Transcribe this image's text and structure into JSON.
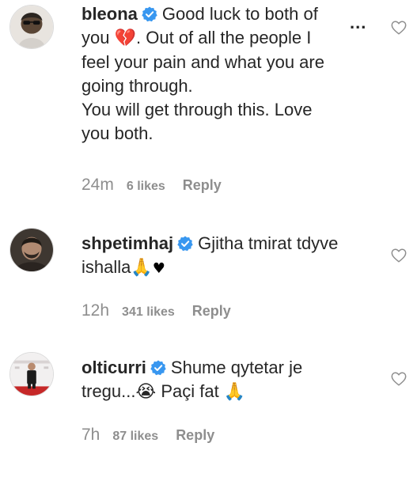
{
  "comments": [
    {
      "username": "bleona",
      "lines": [
        "Good luck to both of",
        "you",
        ". Out of all the people I",
        "feel your pain and what you are",
        "going through.",
        "You will get through this. Love",
        "you both."
      ],
      "emoji_1": "💔",
      "time": "24m",
      "likes": "6 likes",
      "reply": "Reply",
      "more_label": "...",
      "icon": "heart-outline-icon"
    },
    {
      "username": "shpetimhaj",
      "lines": [
        "Gjitha tmirat tdyve",
        "ishalla"
      ],
      "emoji_1": "🙏",
      "emoji_2": "♥",
      "time": "12h",
      "likes": "341 likes",
      "reply": "Reply",
      "icon": "heart-outline-icon"
    },
    {
      "username": "olticurri",
      "lines": [
        "Shume qytetar je",
        "tregu...",
        "Paçi fat"
      ],
      "emoji_1": "😭",
      "emoji_2": "🙏",
      "time": "7h",
      "likes": "87 likes",
      "reply": "Reply",
      "icon": "heart-outline-icon"
    }
  ],
  "colors": {
    "text": "#262626",
    "meta": "#8e8e8e",
    "verified": "#3897f0",
    "broken_heart": "#b8003a"
  }
}
